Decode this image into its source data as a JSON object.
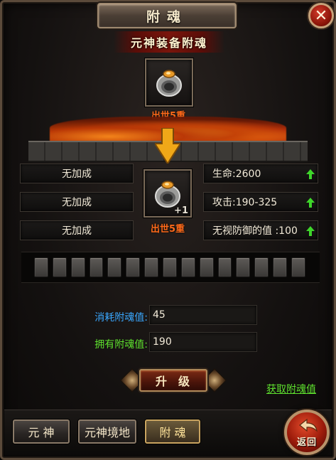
{
  "title": "附魂",
  "subtitle": "元神装备附魂",
  "top_item": {
    "caption": "出世5重"
  },
  "center_item": {
    "caption": "出世5重",
    "plus": "+1"
  },
  "stats_left": [
    "无加成",
    "无加成",
    "无加成"
  ],
  "stats_right": [
    "生命:2600",
    "攻击:190-325",
    "无视防御的值 :100"
  ],
  "slots_count": 15,
  "consume": {
    "label": "消耗附魂值:",
    "value": "45",
    "color": "#3aa8ff"
  },
  "owned": {
    "label": "拥有附魂值:",
    "value": "190",
    "color": "#5ee02e"
  },
  "upgrade_label": "升级",
  "get_link": "获取附魂值",
  "tabs": [
    "元 神",
    "元神境地",
    "附 魂"
  ],
  "active_tab": 2,
  "return_label": "返回"
}
